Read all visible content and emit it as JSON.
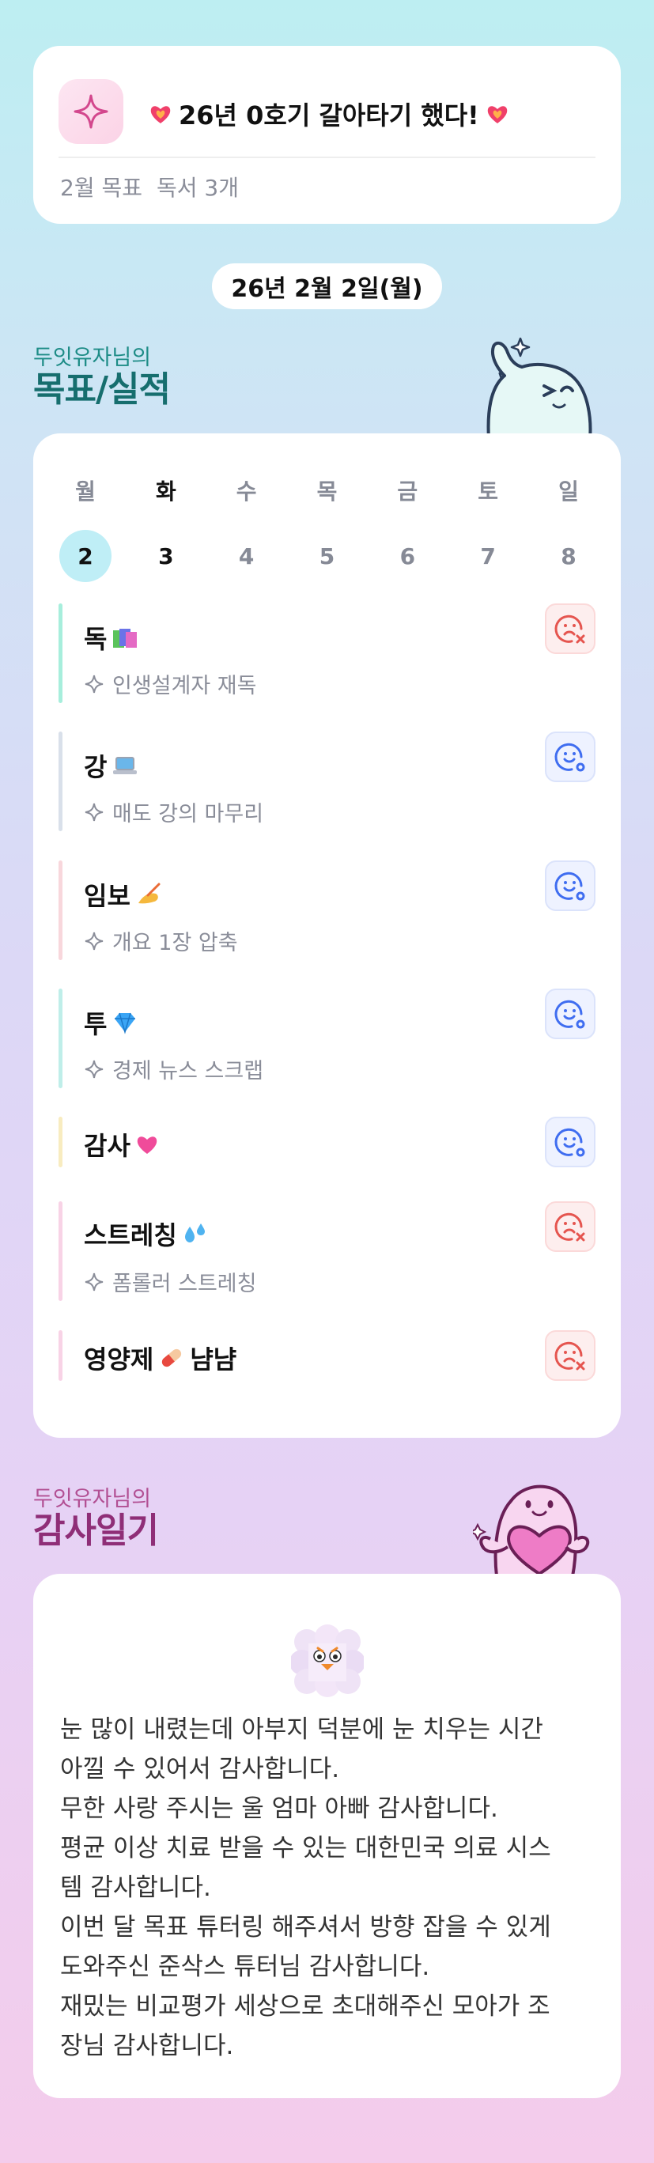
{
  "top_card": {
    "headline": "26년 0호기 갈아타기 했다!",
    "goal_label": "2월 목표",
    "goal_value": "독서 3개"
  },
  "date_pill": "26년 2월 2일(월)",
  "goals_section": {
    "subtitle": "두잇유자님의",
    "title": "목표/실적"
  },
  "week": [
    {
      "name": "월",
      "num": "2",
      "selected": true
    },
    {
      "name": "화",
      "num": "3",
      "today": true
    },
    {
      "name": "수",
      "num": "4"
    },
    {
      "name": "목",
      "num": "5"
    },
    {
      "name": "금",
      "num": "6"
    },
    {
      "name": "토",
      "num": "7"
    },
    {
      "name": "일",
      "num": "8"
    }
  ],
  "goals": [
    {
      "title": "독",
      "emoji": "books-icon",
      "sub": "인생설계자 재독",
      "status": "fail",
      "bar_color": "#a7eedc"
    },
    {
      "title": "강",
      "emoji": "laptop-icon",
      "sub": "매도 강의 마무리",
      "status": "done",
      "bar_color": "#d9e0ea"
    },
    {
      "title": "임보",
      "emoji": "writing-hand-icon",
      "sub": "개요 1장 압축",
      "status": "done",
      "bar_color": "#f8d7dc"
    },
    {
      "title": "투",
      "emoji": "gem-icon",
      "sub": "경제 뉴스 스크랩",
      "status": "done",
      "bar_color": "#bfeee9"
    },
    {
      "title": "감사",
      "emoji": "pink-heart-icon",
      "sub": "",
      "status": "done",
      "bar_color": "#f8ecc0"
    },
    {
      "title": "스트레칭",
      "emoji": "sweat-drops-icon",
      "sub": "폼롤러 스트레칭",
      "status": "fail",
      "bar_color": "#f8d3e6"
    },
    {
      "title": "영양제",
      "emoji": "pill-icon",
      "title_suffix": "냠냠",
      "sub": "",
      "status": "fail",
      "bar_color": "#f8d3e6"
    }
  ],
  "gratitude_section": {
    "subtitle": "두잇유자님의",
    "title": "감사일기"
  },
  "gratitude_lines": [
    "눈 많이 내렸는데 아부지 덕분에 눈 치우는 시간",
    "아낄 수 있어서 감사합니다.",
    "무한 사랑 주시는 울 엄마 아빠 감사합니다.",
    "평균 이상 치료 받을 수 있는 대한민국 의료 시스",
    "템 감사합니다.",
    "이번 달 목표 튜터링 해주셔서 방향 잡을 수 있게",
    "도와주신 준삭스 튜터님 감사합니다.",
    "재밌는 비교평가 세상으로 초대해주신 모아가 조",
    "장님 감사합니다."
  ],
  "colors": {
    "accent_teal": "#166e6e",
    "accent_plum": "#8f2e77",
    "fail_red": "#e5554f",
    "done_blue": "#3f6df0"
  }
}
